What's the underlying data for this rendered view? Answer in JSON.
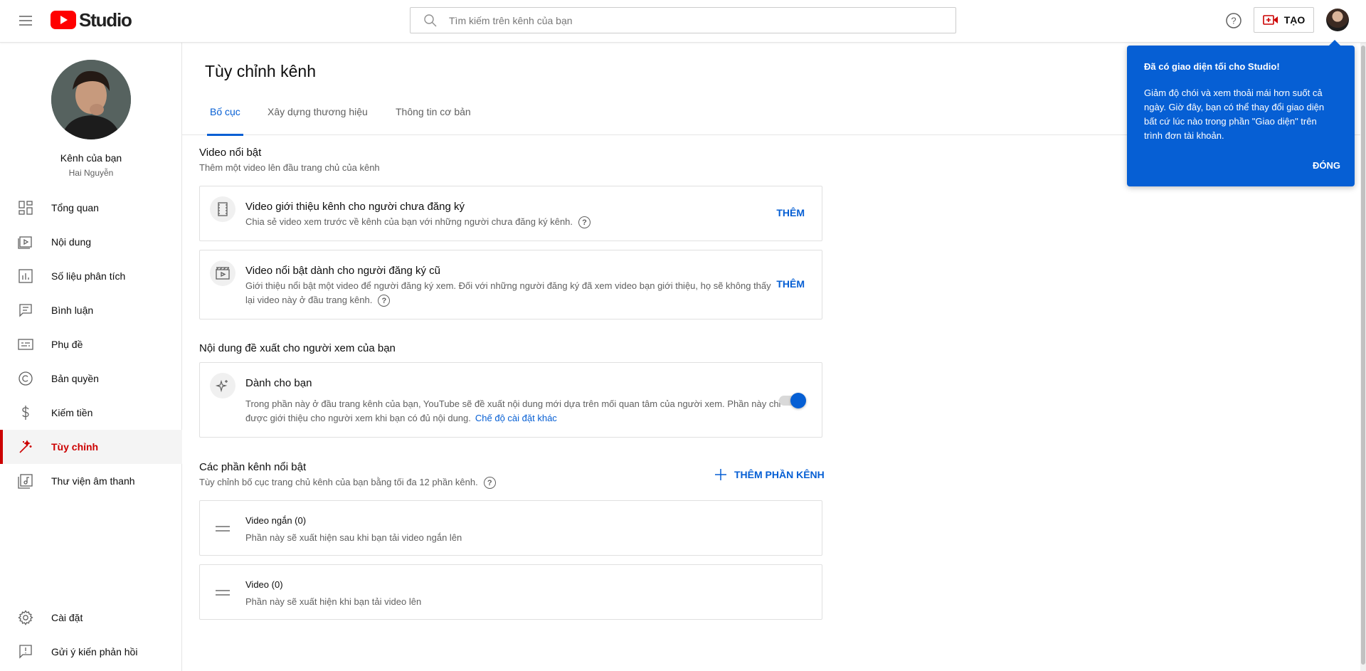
{
  "topbar": {
    "logo_text": "Studio",
    "search_placeholder": "Tìm kiếm trên kênh của bạn",
    "create_label": "TẠO"
  },
  "sidebar": {
    "channel_title": "Kênh của bạn",
    "channel_owner": "Hai Nguyễn",
    "items": [
      {
        "label": "Tổng quan",
        "icon": "dashboard-icon"
      },
      {
        "label": "Nội dung",
        "icon": "content-icon"
      },
      {
        "label": "Số liệu phân tích",
        "icon": "analytics-icon"
      },
      {
        "label": "Bình luận",
        "icon": "comments-icon"
      },
      {
        "label": "Phụ đề",
        "icon": "subtitles-icon"
      },
      {
        "label": "Bản quyền",
        "icon": "copyright-icon"
      },
      {
        "label": "Kiếm tiền",
        "icon": "dollar-icon"
      },
      {
        "label": "Tùy chỉnh",
        "icon": "magic-wand-icon",
        "active": true
      },
      {
        "label": "Thư viện âm thanh",
        "icon": "audio-library-icon"
      }
    ],
    "settings_label": "Cài đặt",
    "feedback_label": "Gửi ý kiến phản hồi"
  },
  "main": {
    "title": "Tùy chỉnh kênh",
    "tabs": [
      {
        "label": "Bố cục",
        "active": true
      },
      {
        "label": "Xây dựng thương hiệu"
      },
      {
        "label": "Thông tin cơ bản"
      }
    ],
    "featured": {
      "title": "Video nổi bật",
      "desc": "Thêm một video lên đầu trang chủ của kênh",
      "trailer": {
        "title": "Video giới thiệu kênh cho người chưa đăng ký",
        "desc": "Chia sẻ video xem trước về kênh của bạn với những người chưa đăng ký kênh.",
        "action": "THÊM"
      },
      "returning": {
        "title": "Video nổi bật dành cho người đăng ký cũ",
        "desc_line1": "Giới thiệu nổi bật một video để người đăng ký xem. Đối với những người đăng ký đã xem video bạn giới thiệu, họ sẽ không thấy",
        "desc_line2": "lại video này ở đầu trang kênh.",
        "action": "THÊM"
      }
    },
    "recommend": {
      "title": "Nội dung đề xuất cho người xem của bạn",
      "for_you": {
        "title": "Dành cho bạn",
        "desc_line1": "Trong phần này ở đầu trang kênh của bạn, YouTube sẽ đề xuất nội dung mới dựa trên mối quan tâm của người xem. Phần này chỉ",
        "desc_line2": "được giới thiệu cho người xem khi bạn có đủ nội dung.",
        "link": "Chế độ cài đặt khác",
        "toggle_on": true
      }
    },
    "sections": {
      "title": "Các phần kênh nổi bật",
      "desc": "Tùy chỉnh bố cục trang chủ kênh của bạn bằng tối đa 12 phần kênh.",
      "add_label": "THÊM PHẦN KÊNH",
      "items": [
        {
          "title": "Video ngắn",
          "count": "(0)",
          "desc": "Phần này sẽ xuất hiện sau khi bạn tải video ngắn lên"
        },
        {
          "title": "Video",
          "count": "(0)",
          "desc": "Phần này sẽ xuất hiện khi bạn tải video lên"
        }
      ]
    }
  },
  "tooltip": {
    "title": "Đã có giao diện tối cho Studio!",
    "body": "Giảm độ chói và xem thoải mái hơn suốt cả ngày. Giờ đây, bạn có thể thay đổi giao diện bất cứ lúc nào trong phần \"Giao diện\" trên trình đơn tài khoản.",
    "close_label": "ĐÓNG"
  },
  "colors": {
    "accent": "#065fd4",
    "active_nav": "#cc0000",
    "logo_red": "#ff0000"
  }
}
